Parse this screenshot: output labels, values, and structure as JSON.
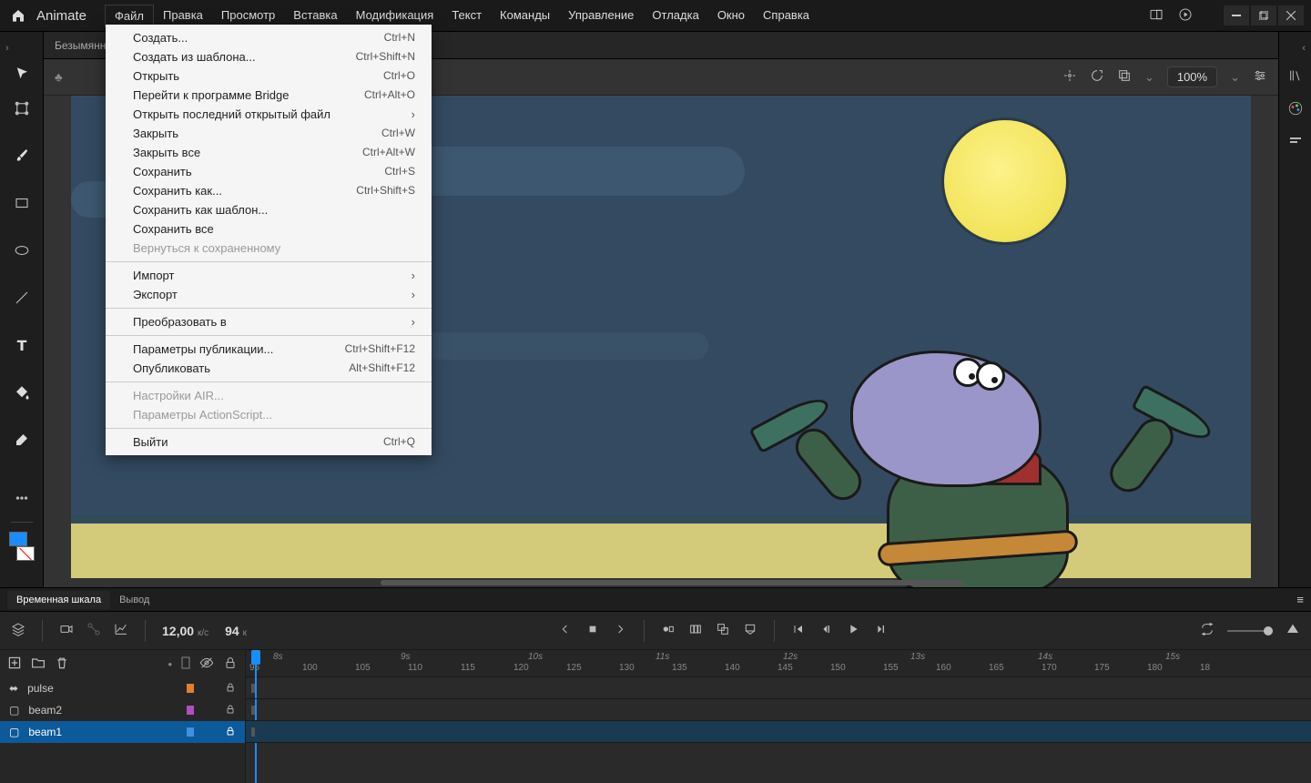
{
  "app": {
    "name": "Animate"
  },
  "menubar": [
    "Файл",
    "Правка",
    "Просмотр",
    "Вставка",
    "Модификация",
    "Текст",
    "Команды",
    "Управление",
    "Отладка",
    "Окно",
    "Справка"
  ],
  "doc_tab": "Безымянн",
  "zoom": "100%",
  "file_menu": [
    {
      "label": "Создать...",
      "shortcut": "Ctrl+N"
    },
    {
      "label": "Создать из шаблона...",
      "shortcut": "Ctrl+Shift+N"
    },
    {
      "label": "Открыть",
      "shortcut": "Ctrl+O"
    },
    {
      "label": "Перейти к программе Bridge",
      "shortcut": "Ctrl+Alt+O"
    },
    {
      "label": "Открыть последний открытый файл",
      "arrow": true
    },
    {
      "label": "Закрыть",
      "shortcut": "Ctrl+W"
    },
    {
      "label": "Закрыть все",
      "shortcut": "Ctrl+Alt+W"
    },
    {
      "label": "Сохранить",
      "shortcut": "Ctrl+S"
    },
    {
      "label": "Сохранить как...",
      "shortcut": "Ctrl+Shift+S"
    },
    {
      "label": "Сохранить как шаблон..."
    },
    {
      "label": "Сохранить все"
    },
    {
      "label": "Вернуться к сохраненному",
      "disabled": true
    },
    {
      "sep": true
    },
    {
      "label": "Импорт",
      "arrow": true
    },
    {
      "label": "Экспорт",
      "arrow": true
    },
    {
      "sep": true
    },
    {
      "label": "Преобразовать в",
      "arrow": true
    },
    {
      "sep": true
    },
    {
      "label": "Параметры публикации...",
      "shortcut": "Ctrl+Shift+F12"
    },
    {
      "label": "Опубликовать",
      "shortcut": "Alt+Shift+F12"
    },
    {
      "sep": true
    },
    {
      "label": "Настройки AIR...",
      "disabled": true
    },
    {
      "label": "Параметры ActionScript...",
      "disabled": true
    },
    {
      "sep": true
    },
    {
      "label": "Выйти",
      "shortcut": "Ctrl+Q"
    }
  ],
  "timeline": {
    "tabs": [
      "Временная шкала",
      "Вывод"
    ],
    "fps_value": "12,00",
    "fps_unit": "к/с",
    "frame_value": "94",
    "frame_unit": "к",
    "seconds": [
      "8s",
      "9s",
      "10s",
      "11s",
      "12s",
      "13s",
      "14s",
      "15s"
    ],
    "frames": [
      "95",
      "100",
      "105",
      "110",
      "115",
      "120",
      "125",
      "130",
      "135",
      "140",
      "145",
      "150",
      "155",
      "160",
      "165",
      "170",
      "175",
      "180",
      "18"
    ],
    "layers": [
      {
        "name": "pulse",
        "color": "#e08030",
        "sel": false,
        "icon": "motion"
      },
      {
        "name": "beam2",
        "color": "#b050c0",
        "sel": false,
        "icon": "layer"
      },
      {
        "name": "beam1",
        "color": "#4090e0",
        "sel": true,
        "icon": "layer"
      }
    ]
  },
  "colors": {
    "fill": "#1a8cff",
    "stroke": "#ffffff"
  }
}
